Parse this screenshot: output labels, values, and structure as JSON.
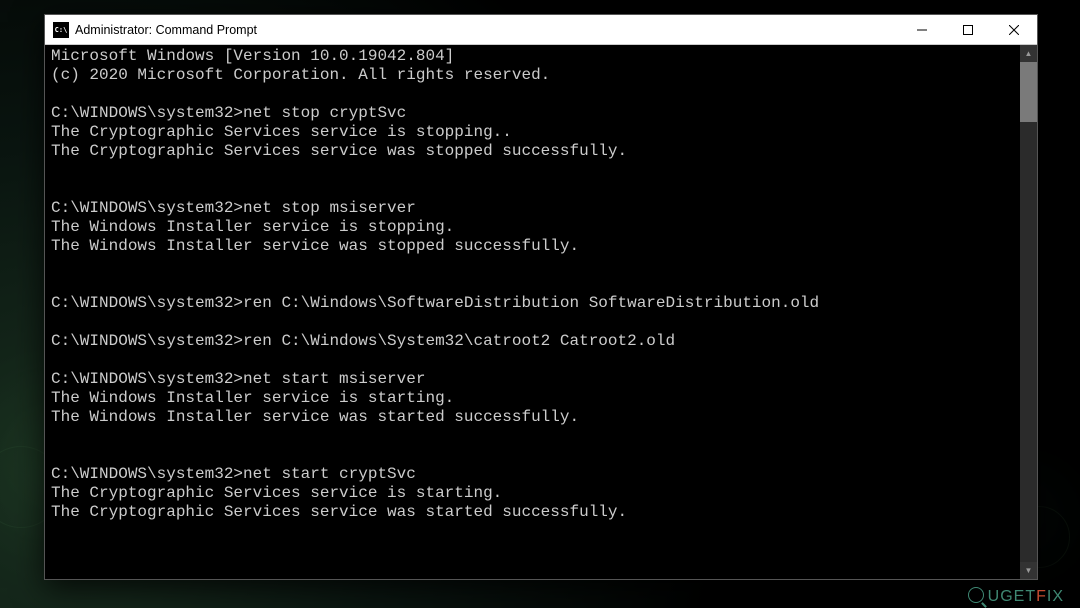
{
  "window": {
    "icon_text": "C:\\",
    "title": "Administrator: Command Prompt"
  },
  "terminal": {
    "lines": [
      "Microsoft Windows [Version 10.0.19042.804]",
      "(c) 2020 Microsoft Corporation. All rights reserved.",
      "",
      "C:\\WINDOWS\\system32>net stop cryptSvc",
      "The Cryptographic Services service is stopping..",
      "The Cryptographic Services service was stopped successfully.",
      "",
      "",
      "C:\\WINDOWS\\system32>net stop msiserver",
      "The Windows Installer service is stopping.",
      "The Windows Installer service was stopped successfully.",
      "",
      "",
      "C:\\WINDOWS\\system32>ren C:\\Windows\\SoftwareDistribution SoftwareDistribution.old",
      "",
      "C:\\WINDOWS\\system32>ren C:\\Windows\\System32\\catroot2 Catroot2.old",
      "",
      "C:\\WINDOWS\\system32>net start msiserver",
      "The Windows Installer service is starting.",
      "The Windows Installer service was started successfully.",
      "",
      "",
      "C:\\WINDOWS\\system32>net start cryptSvc",
      "The Cryptographic Services service is starting.",
      "The Cryptographic Services service was started successfully.",
      "",
      ""
    ]
  },
  "watermark": {
    "prefix": "UGET",
    "accent": "F",
    "suffix": "IX"
  }
}
